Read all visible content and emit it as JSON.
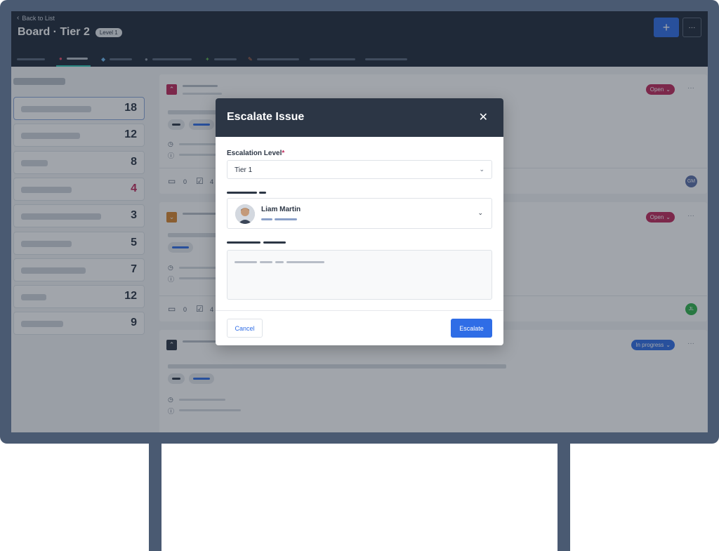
{
  "header": {
    "back_label": "Back to List",
    "back_icon": "chevron-left-icon",
    "title": "Board · Tier 2",
    "level_badge": "Level 1",
    "add_button_glyph": "+",
    "more_button_glyph": "···"
  },
  "sidebar": {
    "counts": [
      "18",
      "12",
      "8",
      "4",
      "3",
      "5",
      "7",
      "12",
      "9"
    ]
  },
  "cards": [
    {
      "status": "Open",
      "status_color": "#c0285a",
      "priority_color": "#c0285a",
      "comments": "0",
      "tasks": "4",
      "assignee_initials": "GM",
      "assignee_color": "#5b6fa8"
    },
    {
      "status": "Open",
      "status_color": "#c0285a",
      "priority_color": "#d8862d",
      "comments": "0",
      "tasks": "4",
      "assignee_initials": "JL",
      "assignee_color": "#2fb24a"
    },
    {
      "status": "In progress",
      "status_color": "#2f6de6",
      "priority_color": "#2c3645"
    }
  ],
  "modal": {
    "title": "Escalate Issue",
    "close_glyph": "✕",
    "escalation_label": "Escalation Level",
    "required_mark": "*",
    "escalation_value": "Tier 1",
    "assignee_name": "Liam Martin",
    "cancel_label": "Cancel",
    "escalate_label": "Escalate"
  },
  "colors": {
    "accent": "#2f6de6",
    "header_bg": "#1f2a3a",
    "modal_head_bg": "#2c3645",
    "tab_active": "#2fc6b4",
    "danger": "#c0285a"
  }
}
